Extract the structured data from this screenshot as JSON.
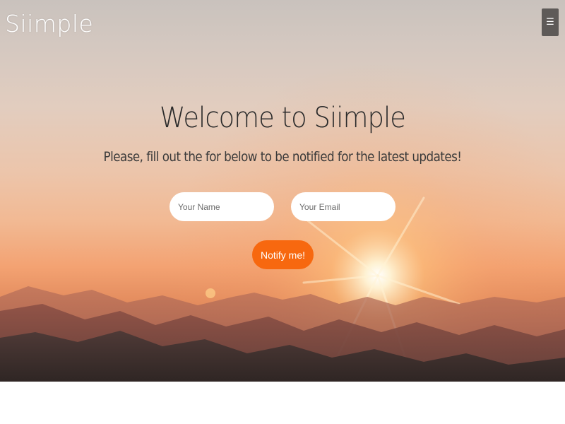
{
  "header": {
    "logo_text": "Siimple",
    "menu_icon": "hamburger-icon"
  },
  "hero": {
    "title": "Welcome to Siimple",
    "subtitle": "Please, fill out the for below to be notified for the latest updates!"
  },
  "form": {
    "name_placeholder": "Your Name",
    "email_placeholder": "Your Email",
    "name_value": "",
    "email_value": "",
    "submit_label": "Notify me!"
  },
  "colors": {
    "accent": "#f7680f",
    "menu_button": "#5e5a58",
    "title_text": "#2b2b2b"
  }
}
